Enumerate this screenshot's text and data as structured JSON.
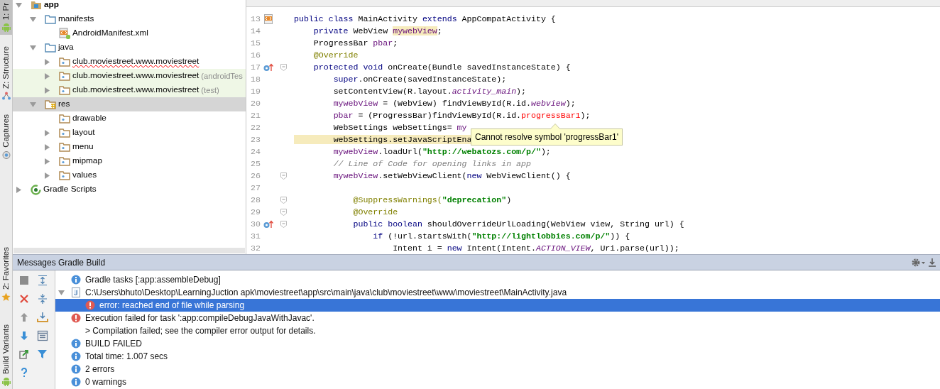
{
  "tool_strip": [
    {
      "label": "1: Pr",
      "selected": true
    },
    {
      "label": "Z: Structure",
      "selected": false
    },
    {
      "label": "Captures",
      "selected": false
    },
    {
      "label": "2: Favorites",
      "selected": false
    },
    {
      "label": "Build Variants",
      "selected": false
    }
  ],
  "project_tree": [
    {
      "label": "app",
      "kind": "module",
      "expanded": true,
      "selected": false,
      "error": false,
      "children": [
        {
          "label": "manifests",
          "kind": "folder",
          "expanded": true,
          "selected": false,
          "error": false,
          "children": [
            {
              "label": "AndroidManifest.xml",
              "kind": "xml",
              "selected": false,
              "error": false
            }
          ]
        },
        {
          "label": "java",
          "kind": "folder",
          "expanded": true,
          "selected": false,
          "error": false,
          "children": [
            {
              "label": "club.moviestreet.www.moviestreet",
              "kind": "package",
              "expanded": false,
              "selected": false,
              "error": true
            },
            {
              "label": "club.moviestreet.www.moviestreet",
              "suffix": "(androidTes",
              "kind": "test-package",
              "expanded": false,
              "selected": false,
              "error": false
            },
            {
              "label": "club.moviestreet.www.moviestreet",
              "suffix": "(test)",
              "kind": "test-package",
              "expanded": false,
              "selected": false,
              "error": false
            }
          ]
        },
        {
          "label": "res",
          "kind": "res",
          "expanded": true,
          "selected": true,
          "error": false,
          "children": [
            {
              "label": "drawable",
              "kind": "package",
              "selected": false,
              "error": false
            },
            {
              "label": "layout",
              "kind": "package",
              "expanded": false,
              "selected": false,
              "error": false
            },
            {
              "label": "menu",
              "kind": "package",
              "expanded": false,
              "selected": false,
              "error": false
            },
            {
              "label": "mipmap",
              "kind": "package",
              "expanded": false,
              "selected": false,
              "error": false
            },
            {
              "label": "values",
              "kind": "package",
              "expanded": false,
              "selected": false,
              "error": false
            }
          ]
        }
      ]
    },
    {
      "label": "Gradle Scripts",
      "kind": "gradle",
      "expanded": false,
      "selected": false,
      "error": false
    }
  ],
  "editor": {
    "lines": [
      {
        "number": "13",
        "kind": "class",
        "fold": false,
        "segments": [
          {
            "text": "public class ",
            "kind": "kw"
          },
          {
            "text": "MainActivity ",
            "kind": "plain"
          },
          {
            "text": "extends ",
            "kind": "kw"
          },
          {
            "text": "AppCompatActivity {",
            "kind": "plain"
          }
        ]
      },
      {
        "number": "14",
        "kind": "plain",
        "fold": false,
        "segments": [
          {
            "text": "    private ",
            "kind": "kw"
          },
          {
            "text": "WebView ",
            "kind": "plain"
          },
          {
            "text": "mywebView",
            "kind": "field",
            "highlight": true
          },
          {
            "text": ";",
            "kind": "plain"
          }
        ]
      },
      {
        "number": "15",
        "kind": "plain",
        "fold": false,
        "segments": [
          {
            "text": "    ProgressBar ",
            "kind": "plain"
          },
          {
            "text": "pbar",
            "kind": "field"
          },
          {
            "text": ";",
            "kind": "plain"
          }
        ]
      },
      {
        "number": "16",
        "kind": "plain",
        "fold": false,
        "segments": [
          {
            "text": "    @Override",
            "kind": "ann"
          }
        ]
      },
      {
        "number": "17",
        "kind": "override",
        "fold": true,
        "segments": [
          {
            "text": "    protected void ",
            "kind": "kw"
          },
          {
            "text": "onCreate(Bundle savedInstanceState) {",
            "kind": "plain"
          }
        ]
      },
      {
        "number": "18",
        "kind": "plain",
        "fold": false,
        "segments": [
          {
            "text": "        super",
            "kind": "kw"
          },
          {
            "text": ".onCreate(savedInstanceState);",
            "kind": "plain"
          }
        ]
      },
      {
        "number": "19",
        "kind": "plain",
        "fold": false,
        "segments": [
          {
            "text": "        setContentView(R.layout.",
            "kind": "plain"
          },
          {
            "text": "activity_main",
            "kind": "static"
          },
          {
            "text": ");",
            "kind": "plain"
          }
        ]
      },
      {
        "number": "20",
        "kind": "plain",
        "fold": false,
        "segments": [
          {
            "text": "        mywebView",
            "kind": "field"
          },
          {
            "text": " = (WebView) findViewById(R.id.",
            "kind": "plain"
          },
          {
            "text": "webview",
            "kind": "static"
          },
          {
            "text": ");",
            "kind": "plain"
          }
        ]
      },
      {
        "number": "21",
        "kind": "plain",
        "fold": false,
        "segments": [
          {
            "text": "        pbar",
            "kind": "field"
          },
          {
            "text": " = (ProgressBar)findViewById(R.id.",
            "kind": "plain"
          },
          {
            "text": "progressBar1",
            "kind": "err"
          },
          {
            "text": ");",
            "kind": "plain"
          }
        ]
      },
      {
        "number": "22",
        "kind": "plain",
        "fold": false,
        "segments": [
          {
            "text": "        WebSettings webSettings= ",
            "kind": "plain"
          },
          {
            "text": "my",
            "kind": "field"
          }
        ]
      },
      {
        "number": "23",
        "kind": "plain",
        "fold": false,
        "segments": [
          {
            "text": "        webSettings.setJavaScriptEna",
            "kind": "plain",
            "highlight": true
          }
        ]
      },
      {
        "number": "24",
        "kind": "plain",
        "fold": false,
        "segments": [
          {
            "text": "        mywebView",
            "kind": "field"
          },
          {
            "text": ".loadUrl(",
            "kind": "plain"
          },
          {
            "text": "\"http://webatozs.com/p/\"",
            "kind": "str"
          },
          {
            "text": ");",
            "kind": "plain"
          }
        ]
      },
      {
        "number": "25",
        "kind": "plain",
        "fold": false,
        "segments": [
          {
            "text": "        // Line of Code for opening links in app",
            "kind": "comment"
          }
        ]
      },
      {
        "number": "26",
        "kind": "plain",
        "fold": true,
        "segments": [
          {
            "text": "        mywebView",
            "kind": "field"
          },
          {
            "text": ".setWebViewClient(",
            "kind": "plain"
          },
          {
            "text": "new ",
            "kind": "kw"
          },
          {
            "text": "WebViewClient() {",
            "kind": "plain"
          }
        ]
      },
      {
        "number": "27",
        "kind": "plain",
        "fold": false
      },
      {
        "number": "28",
        "kind": "plain",
        "fold": true,
        "segments": [
          {
            "text": "            @SuppressWarnings(",
            "kind": "ann"
          },
          {
            "text": "\"deprecation\"",
            "kind": "str"
          },
          {
            "text": ")",
            "kind": "plain"
          }
        ]
      },
      {
        "number": "29",
        "kind": "plain",
        "fold": true,
        "segments": [
          {
            "text": "            @Override",
            "kind": "ann"
          }
        ]
      },
      {
        "number": "30",
        "kind": "override",
        "fold": true,
        "segments": [
          {
            "text": "            public boolean ",
            "kind": "kw"
          },
          {
            "text": "shouldOverrideUrlLoading(WebView view, String url) {",
            "kind": "plain"
          }
        ]
      },
      {
        "number": "31",
        "kind": "plain",
        "fold": false,
        "segments": [
          {
            "text": "                if ",
            "kind": "kw"
          },
          {
            "text": "(!url.startsWith(",
            "kind": "plain"
          },
          {
            "text": "\"http://lightlobbies.com/p/\"",
            "kind": "str"
          },
          {
            "text": ")) {",
            "kind": "plain"
          }
        ]
      },
      {
        "number": "32",
        "kind": "plain",
        "fold": false,
        "segments": [
          {
            "text": "                    Intent i = ",
            "kind": "plain"
          },
          {
            "text": "new ",
            "kind": "kw"
          },
          {
            "text": "Intent(Intent.",
            "kind": "plain"
          },
          {
            "text": "ACTION_VIEW",
            "kind": "static"
          },
          {
            "text": ", Uri.parse(url));",
            "kind": "plain"
          }
        ]
      }
    ],
    "tooltip": "Cannot resolve symbol 'progressBar1'"
  },
  "messages_panel": {
    "title": "Messages Gradle Build",
    "messages": [
      {
        "kind": "info",
        "lines": [
          "Gradle tasks [:app:assembleDebug]"
        ],
        "selected": false
      },
      {
        "kind": "file",
        "lines": [
          "C:\\Users\\bhuto\\Desktop\\LearningJuction apk\\moviestreet\\app\\src\\main\\java\\club\\moviestreet\\www\\moviestreet\\MainActivity.java"
        ],
        "expanded": true,
        "selected": false,
        "children": [
          {
            "kind": "error",
            "lines": [
              "error: reached end of file while parsing"
            ],
            "selected": true
          }
        ]
      },
      {
        "kind": "error",
        "lines": [
          "Execution failed for task ':app:compileDebugJavaWithJavac'.",
          "> Compilation failed; see the compiler error output for details."
        ],
        "selected": false
      },
      {
        "kind": "info",
        "lines": [
          "BUILD FAILED"
        ],
        "selected": false
      },
      {
        "kind": "info",
        "lines": [
          "Total time: 1.007 secs"
        ],
        "selected": false
      },
      {
        "kind": "info",
        "lines": [
          "2 errors"
        ],
        "selected": false
      },
      {
        "kind": "info",
        "lines": [
          "0 warnings"
        ],
        "selected": false
      }
    ]
  }
}
